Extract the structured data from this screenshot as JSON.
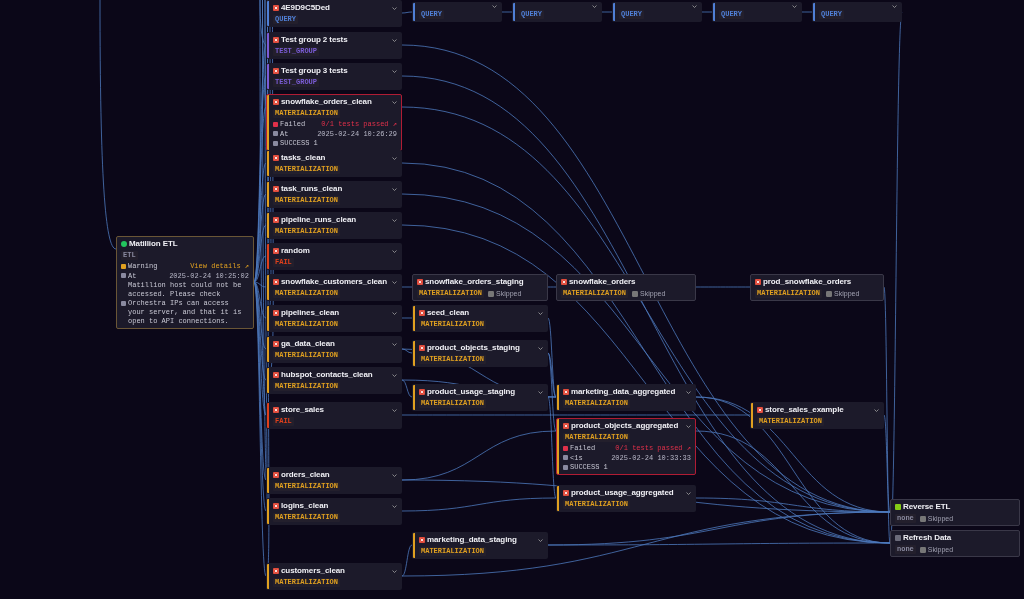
{
  "nodes": [
    {
      "kind": "query",
      "title": "4E9D9C5Ded",
      "color": "#4f7fd6",
      "badge": "QUERY"
    },
    {
      "kind": "query",
      "color": "#4f7fd6",
      "badge": "QUERY"
    },
    {
      "kind": "query",
      "color": "#4f7fd6",
      "badge": "QUERY"
    },
    {
      "kind": "query",
      "color": "#4f7fd6",
      "badge": "QUERY"
    },
    {
      "kind": "query",
      "color": "#4f7fd6",
      "badge": "QUERY"
    },
    {
      "kind": "query",
      "color": "#4f7fd6",
      "badge": "QUERY"
    },
    {
      "kind": "task",
      "title": "Test group 2 tests",
      "color": "#7a5cd6",
      "badge": "TEST_GROUP"
    },
    {
      "kind": "task",
      "title": "Test group 3 tests",
      "color": "#7a5cd6",
      "badge": "TEST_GROUP"
    },
    {
      "kind": "detail",
      "title": "snowflake_orders_clean",
      "color": "#e0a020",
      "badge": "MATERIALIZATION",
      "failed": true,
      "rows": [
        {
          "kind": "status",
          "label": "Failed",
          "value": "0/1 tests passed ↗"
        },
        {
          "kind": "time",
          "label": "At",
          "value": "2025-02-24 10:26:29"
        },
        {
          "kind": "count",
          "label": "SUCCESS 1"
        }
      ]
    },
    {
      "kind": "task",
      "title": "tasks_clean",
      "color": "#e0a020",
      "badge": "MATERIALIZATION"
    },
    {
      "kind": "task",
      "title": "task_runs_clean",
      "color": "#e0a020",
      "badge": "MATERIALIZATION"
    },
    {
      "kind": "task",
      "title": "pipeline_runs_clean",
      "color": "#e0a020",
      "badge": "MATERIALIZATION"
    },
    {
      "kind": "task",
      "title": "random",
      "color": "#e0401c",
      "badge": "FAIL"
    },
    {
      "kind": "task",
      "title": "snowflake_customers_clean",
      "color": "#e0a020",
      "badge": "MATERIALIZATION"
    },
    {
      "kind": "task",
      "title": "pipelines_clean",
      "color": "#e0a020",
      "badge": "MATERIALIZATION"
    },
    {
      "kind": "task",
      "title": "ga_data_clean",
      "color": "#e0a020",
      "badge": "MATERIALIZATION"
    },
    {
      "kind": "task",
      "title": "hubspot_contacts_clean",
      "color": "#e0a020",
      "badge": "MATERIALIZATION"
    },
    {
      "kind": "task",
      "title": "store_sales",
      "color": "#e0401c",
      "badge": "FAIL"
    },
    {
      "kind": "task",
      "title": "orders_clean",
      "color": "#e0a020",
      "badge": "MATERIALIZATION"
    },
    {
      "kind": "task",
      "title": "logins_clean",
      "color": "#e0a020",
      "badge": "MATERIALIZATION"
    },
    {
      "kind": "task",
      "title": "customers_clean",
      "color": "#e0a020",
      "badge": "MATERIALIZATION"
    },
    {
      "kind": "source",
      "title": "Matillion ETL",
      "color": "#22c55e",
      "badge": "ETL",
      "rows": [
        {
          "kind": "warning",
          "label": "Warning",
          "value": "View details ↗"
        },
        {
          "kind": "time",
          "label": "At",
          "value": "2025-02-24 10:25:02"
        },
        {
          "kind": "message",
          "label": "Matillion host could not be accessed. Please check Orchestra IPs can access your server, and that it is open to API connections."
        }
      ]
    },
    {
      "kind": "integration",
      "title": "snowflake_orders_staging",
      "color": "#e0a020",
      "badge": "MATERIALIZATION",
      "chip": "Skipped"
    },
    {
      "kind": "task",
      "title": "seed_clean",
      "color": "#e0a020",
      "badge": "MATERIALIZATION"
    },
    {
      "kind": "task",
      "title": "product_objects_staging",
      "color": "#e0a020",
      "badge": "MATERIALIZATION"
    },
    {
      "kind": "task",
      "title": "product_usage_staging",
      "color": "#e0a020",
      "badge": "MATERIALIZATION"
    },
    {
      "kind": "task",
      "title": "marketing_data_staging",
      "color": "#e0a020",
      "badge": "MATERIALIZATION"
    },
    {
      "kind": "integration",
      "title": "snowflake_orders",
      "color": "#e0a020",
      "badge": "MATERIALIZATION",
      "chip": "Skipped"
    },
    {
      "kind": "task",
      "title": "marketing_data_aggregated",
      "color": "#e0a020",
      "badge": "MATERIALIZATION"
    },
    {
      "kind": "detail",
      "title": "product_objects_aggregated",
      "color": "#e0a020",
      "badge": "MATERIALIZATION",
      "failed": true,
      "rows": [
        {
          "kind": "status",
          "label": "Failed",
          "value": "0/1 tests passed ↗"
        },
        {
          "kind": "time",
          "label": "<1s",
          "value": "2025-02-24 10:33:33"
        },
        {
          "kind": "count",
          "label": "SUCCESS 1"
        }
      ]
    },
    {
      "kind": "task",
      "title": "product_usage_aggregated",
      "color": "#e0a020",
      "badge": "MATERIALIZATION"
    },
    {
      "kind": "integration",
      "title": "prod_snowflake_orders",
      "color": "#e0a020",
      "badge": "MATERIALIZATION",
      "chip": "Skipped"
    },
    {
      "kind": "task",
      "title": "store_sales_example",
      "color": "#e0a020",
      "badge": "MATERIALIZATION"
    },
    {
      "kind": "trigger",
      "title": "Reverse ETL",
      "color": "#84cc16",
      "badge": "none",
      "chip": "Skipped"
    },
    {
      "kind": "trigger",
      "title": "Refresh Data",
      "color": "#6b6b7a",
      "badge": "none",
      "chip": "Skipped"
    }
  ]
}
